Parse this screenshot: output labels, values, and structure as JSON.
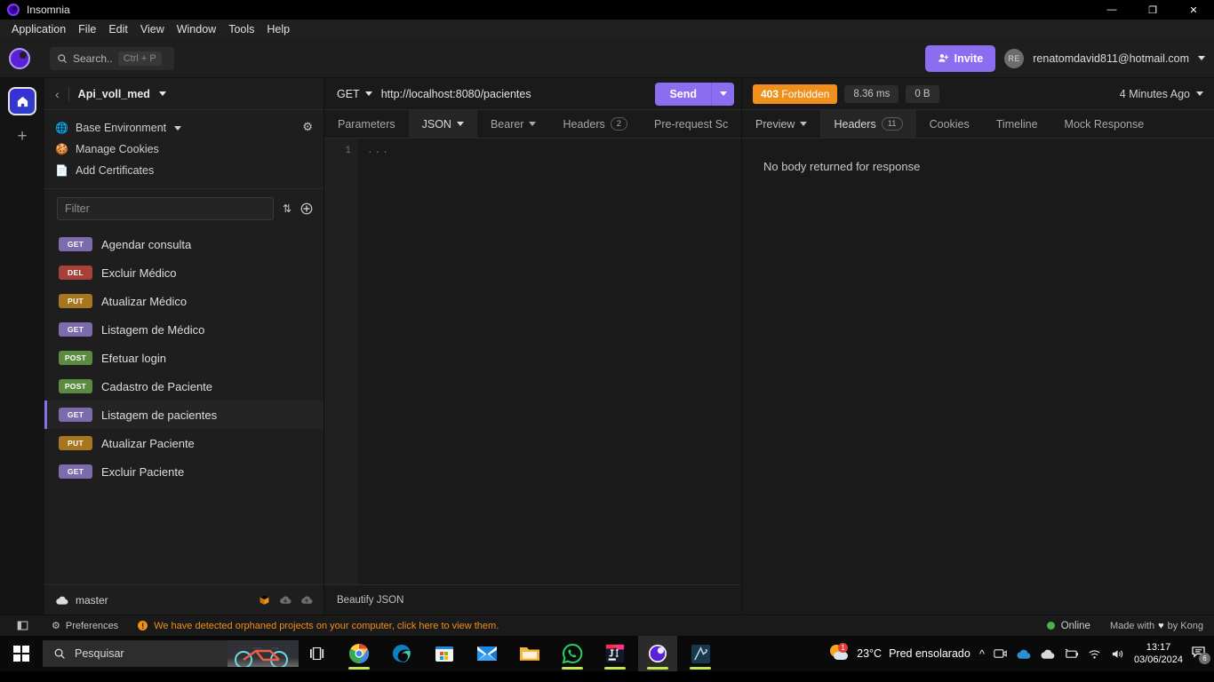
{
  "window": {
    "title": "Insomnia",
    "minimize_label": "—",
    "restore_label": "❐",
    "close_label": "✕"
  },
  "menubar": {
    "items": [
      {
        "label": "Application"
      },
      {
        "label": "File"
      },
      {
        "label": "Edit"
      },
      {
        "label": "View"
      },
      {
        "label": "Window"
      },
      {
        "label": "Tools"
      },
      {
        "label": "Help"
      }
    ]
  },
  "appbar": {
    "search_label": "Search..",
    "search_shortcut": "Ctrl + P",
    "invite_label": "Invite",
    "avatar_initials": "RE",
    "account_email": "renatomdavid811@hotmail.com"
  },
  "rail": {
    "home_icon": "home-icon",
    "add_label": "+"
  },
  "sidebar": {
    "back_label": "‹",
    "workspace_name": "Api_voll_med",
    "env_rows": [
      {
        "label": "Base Environment",
        "icon": "globe-icon",
        "has_caret": true
      },
      {
        "label": "Manage Cookies",
        "icon": "cookie-icon",
        "has_caret": false
      },
      {
        "label": "Add Certificates",
        "icon": "certificate-icon",
        "has_caret": false
      }
    ],
    "filter_placeholder": "Filter",
    "filter_value": "",
    "requests": [
      {
        "method": "GET",
        "name": "Agendar consulta",
        "selected": false
      },
      {
        "method": "DEL",
        "name": "Excluir Médico",
        "selected": false
      },
      {
        "method": "PUT",
        "name": "Atualizar Médico",
        "selected": false
      },
      {
        "method": "GET",
        "name": "Listagem de Médico",
        "selected": false
      },
      {
        "method": "POST",
        "name": "Efetuar login",
        "selected": false
      },
      {
        "method": "POST",
        "name": "Cadastro de Paciente",
        "selected": false
      },
      {
        "method": "GET",
        "name": "Listagem de pacientes",
        "selected": true
      },
      {
        "method": "PUT",
        "name": "Atualizar Paciente",
        "selected": false
      },
      {
        "method": "GET",
        "name": "Excluir Paciente",
        "selected": false
      }
    ],
    "branch": "master"
  },
  "request": {
    "method": "GET",
    "url": "http://localhost:8080/pacientes",
    "send_label": "Send",
    "tabs": [
      {
        "label": "Parameters",
        "active": false,
        "caret": false,
        "badge": ""
      },
      {
        "label": "JSON",
        "active": true,
        "caret": true,
        "badge": ""
      },
      {
        "label": "Bearer",
        "active": false,
        "caret": true,
        "badge": ""
      },
      {
        "label": "Headers",
        "active": false,
        "caret": false,
        "badge": "2"
      },
      {
        "label": "Pre-request Sc",
        "active": false,
        "caret": false,
        "badge": ""
      }
    ],
    "line_number": "1",
    "body_content": "...",
    "beautify_label": "Beautify JSON"
  },
  "response": {
    "status_code": "403",
    "status_text": "Forbidden",
    "time": "8.36 ms",
    "size": "0 B",
    "time_ago": "4 Minutes Ago",
    "tabs": [
      {
        "label": "Preview",
        "active": true,
        "caret": true,
        "badge": ""
      },
      {
        "label": "Headers",
        "active": false,
        "caret": false,
        "badge": "11"
      },
      {
        "label": "Cookies",
        "active": false,
        "caret": false,
        "badge": ""
      },
      {
        "label": "Timeline",
        "active": false,
        "caret": false,
        "badge": ""
      },
      {
        "label": "Mock Response",
        "active": false,
        "caret": false,
        "badge": ""
      }
    ],
    "body_message": "No body returned for response"
  },
  "statusbar": {
    "preferences_label": "Preferences",
    "warning_mark": "!",
    "warning_text": "We have detected orphaned projects on your computer, click here to view them.",
    "online_label": "Online",
    "made_with_prefix": "Made with",
    "made_with_suffix": "by Kong"
  },
  "taskbar": {
    "search_placeholder": "Pesquisar",
    "apps": [
      {
        "name": "chrome",
        "running": true,
        "active": false
      },
      {
        "name": "edge",
        "running": false,
        "active": false
      },
      {
        "name": "store",
        "running": false,
        "active": false
      },
      {
        "name": "mail",
        "running": false,
        "active": false
      },
      {
        "name": "explorer",
        "running": false,
        "active": false
      },
      {
        "name": "whatsapp",
        "running": true,
        "active": false
      },
      {
        "name": "intellij",
        "running": true,
        "active": false
      },
      {
        "name": "insomnia",
        "running": true,
        "active": true
      },
      {
        "name": "vector-app",
        "running": true,
        "active": false
      }
    ],
    "weather_temp": "23°C",
    "weather_desc": "Pred ensolarado",
    "weather_badge": "1",
    "time": "13:17",
    "date": "03/06/2024",
    "notification_count": "6"
  },
  "colors": {
    "accent_purple": "#8b6ef0",
    "status_orange": "#ef8f1c",
    "online_green": "#4caf50"
  }
}
